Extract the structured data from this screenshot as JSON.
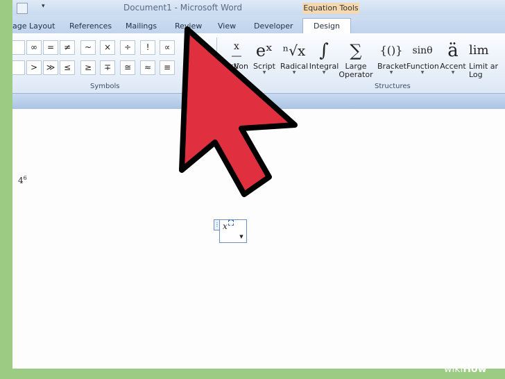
{
  "window": {
    "title": "Document1 - Microsoft Word",
    "contextual_tab": "Equation Tools"
  },
  "tabs": [
    "age Layout",
    "References",
    "Mailings",
    "Review",
    "View",
    "Developer"
  ],
  "active_tab": "Design",
  "symbols": {
    "row1": [
      "∞",
      "=",
      "≠",
      "~",
      "×",
      "÷",
      "!",
      "∝"
    ],
    "row2": [
      "",
      ">",
      "≫",
      "≤",
      "≥",
      "∓",
      "≅",
      "≈",
      "≡"
    ],
    "group_label": "Symbols"
  },
  "structures": {
    "items": [
      {
        "label": "Fraction",
        "display": "action",
        "glyph": "x/y"
      },
      {
        "label": "Script",
        "glyph": "eˣ"
      },
      {
        "label": "Radical",
        "glyph": "ⁿ√x"
      },
      {
        "label": "Integral",
        "glyph": "∫"
      },
      {
        "label": "Large Operator",
        "line1": "Large",
        "line2": "Operator",
        "glyph": "∑"
      },
      {
        "label": "Bracket",
        "glyph": "{()}"
      },
      {
        "label": "Function",
        "glyph": "sinθ"
      },
      {
        "label": "Accent",
        "glyph": "ä"
      },
      {
        "label": "Limit and Log",
        "line1": "Limit ar",
        "line2": "Log",
        "glyph": "lim"
      }
    ],
    "group_label": "Structures"
  },
  "document": {
    "expression": "4",
    "exponent": "6",
    "equation_base": "x"
  },
  "arrow_color": "#e0303f",
  "watermark": {
    "wiki": "wiki",
    "how": "How"
  }
}
